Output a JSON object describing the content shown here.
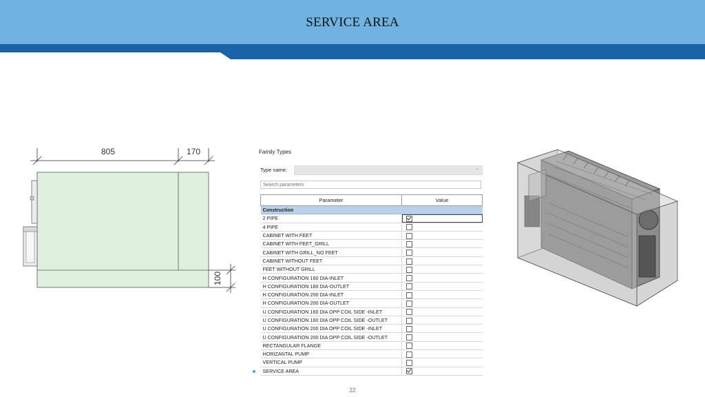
{
  "header": {
    "title": "SERVICE AREA"
  },
  "colors": {
    "header_bg": "#6fb3e0",
    "band": "#1a62a8",
    "group_row": "#b9d2ea"
  },
  "drawing": {
    "dim_width": "805",
    "dim_side": "170",
    "dim_bottom": "100"
  },
  "family_types": {
    "title": "Family Types",
    "type_name_label": "Type name:",
    "type_name_value": "",
    "search_placeholder": "Search parameters",
    "col_parameter": "Parameter",
    "col_value": "Value",
    "group": "Construction",
    "rows": [
      {
        "name": "2 PIPE",
        "checked": true
      },
      {
        "name": "4 PIPE",
        "checked": false
      },
      {
        "name": "CABINET WITH FEET",
        "checked": false
      },
      {
        "name": "CABINET WITH FEET_GRILL",
        "checked": false
      },
      {
        "name": "CABINET WITH GRILL_NO FEET",
        "checked": false
      },
      {
        "name": "CABINET WITHOUT FEET",
        "checked": false
      },
      {
        "name": "FEET WITHOUT GRILL",
        "checked": false
      },
      {
        "name": "H CONFIGURATION 160 DIA-INLET",
        "checked": false
      },
      {
        "name": "H CONFIGURATION 160 DIA-OUTLET",
        "checked": false
      },
      {
        "name": "H CONFIGURATION 200 DIA-INLET",
        "checked": false
      },
      {
        "name": "H CONFIGURATION 200 DIA-OUTLET",
        "checked": false
      },
      {
        "name": "U CONFIGURATION 160 DIA OPP COIL SIDE -INLET",
        "checked": false
      },
      {
        "name": "U CONFIGURATION 160 DIA OPP COIL SIDE -OUTLET",
        "checked": false
      },
      {
        "name": "U CONFIGURATION 200 DIA OPP COIL SIDE -INLET",
        "checked": false
      },
      {
        "name": "U CONFIGURATION 200 DIA OPP COIL SIDE -OUTLET",
        "checked": false
      },
      {
        "name": "RECTANGULAR FLANGE",
        "checked": false
      },
      {
        "name": "HORIZANTAL PUMP",
        "checked": false
      },
      {
        "name": "VERTICAL PUMP",
        "checked": false
      },
      {
        "name": "SERVICE AREA",
        "checked": true
      }
    ]
  },
  "footer": {
    "page_number": "22"
  }
}
